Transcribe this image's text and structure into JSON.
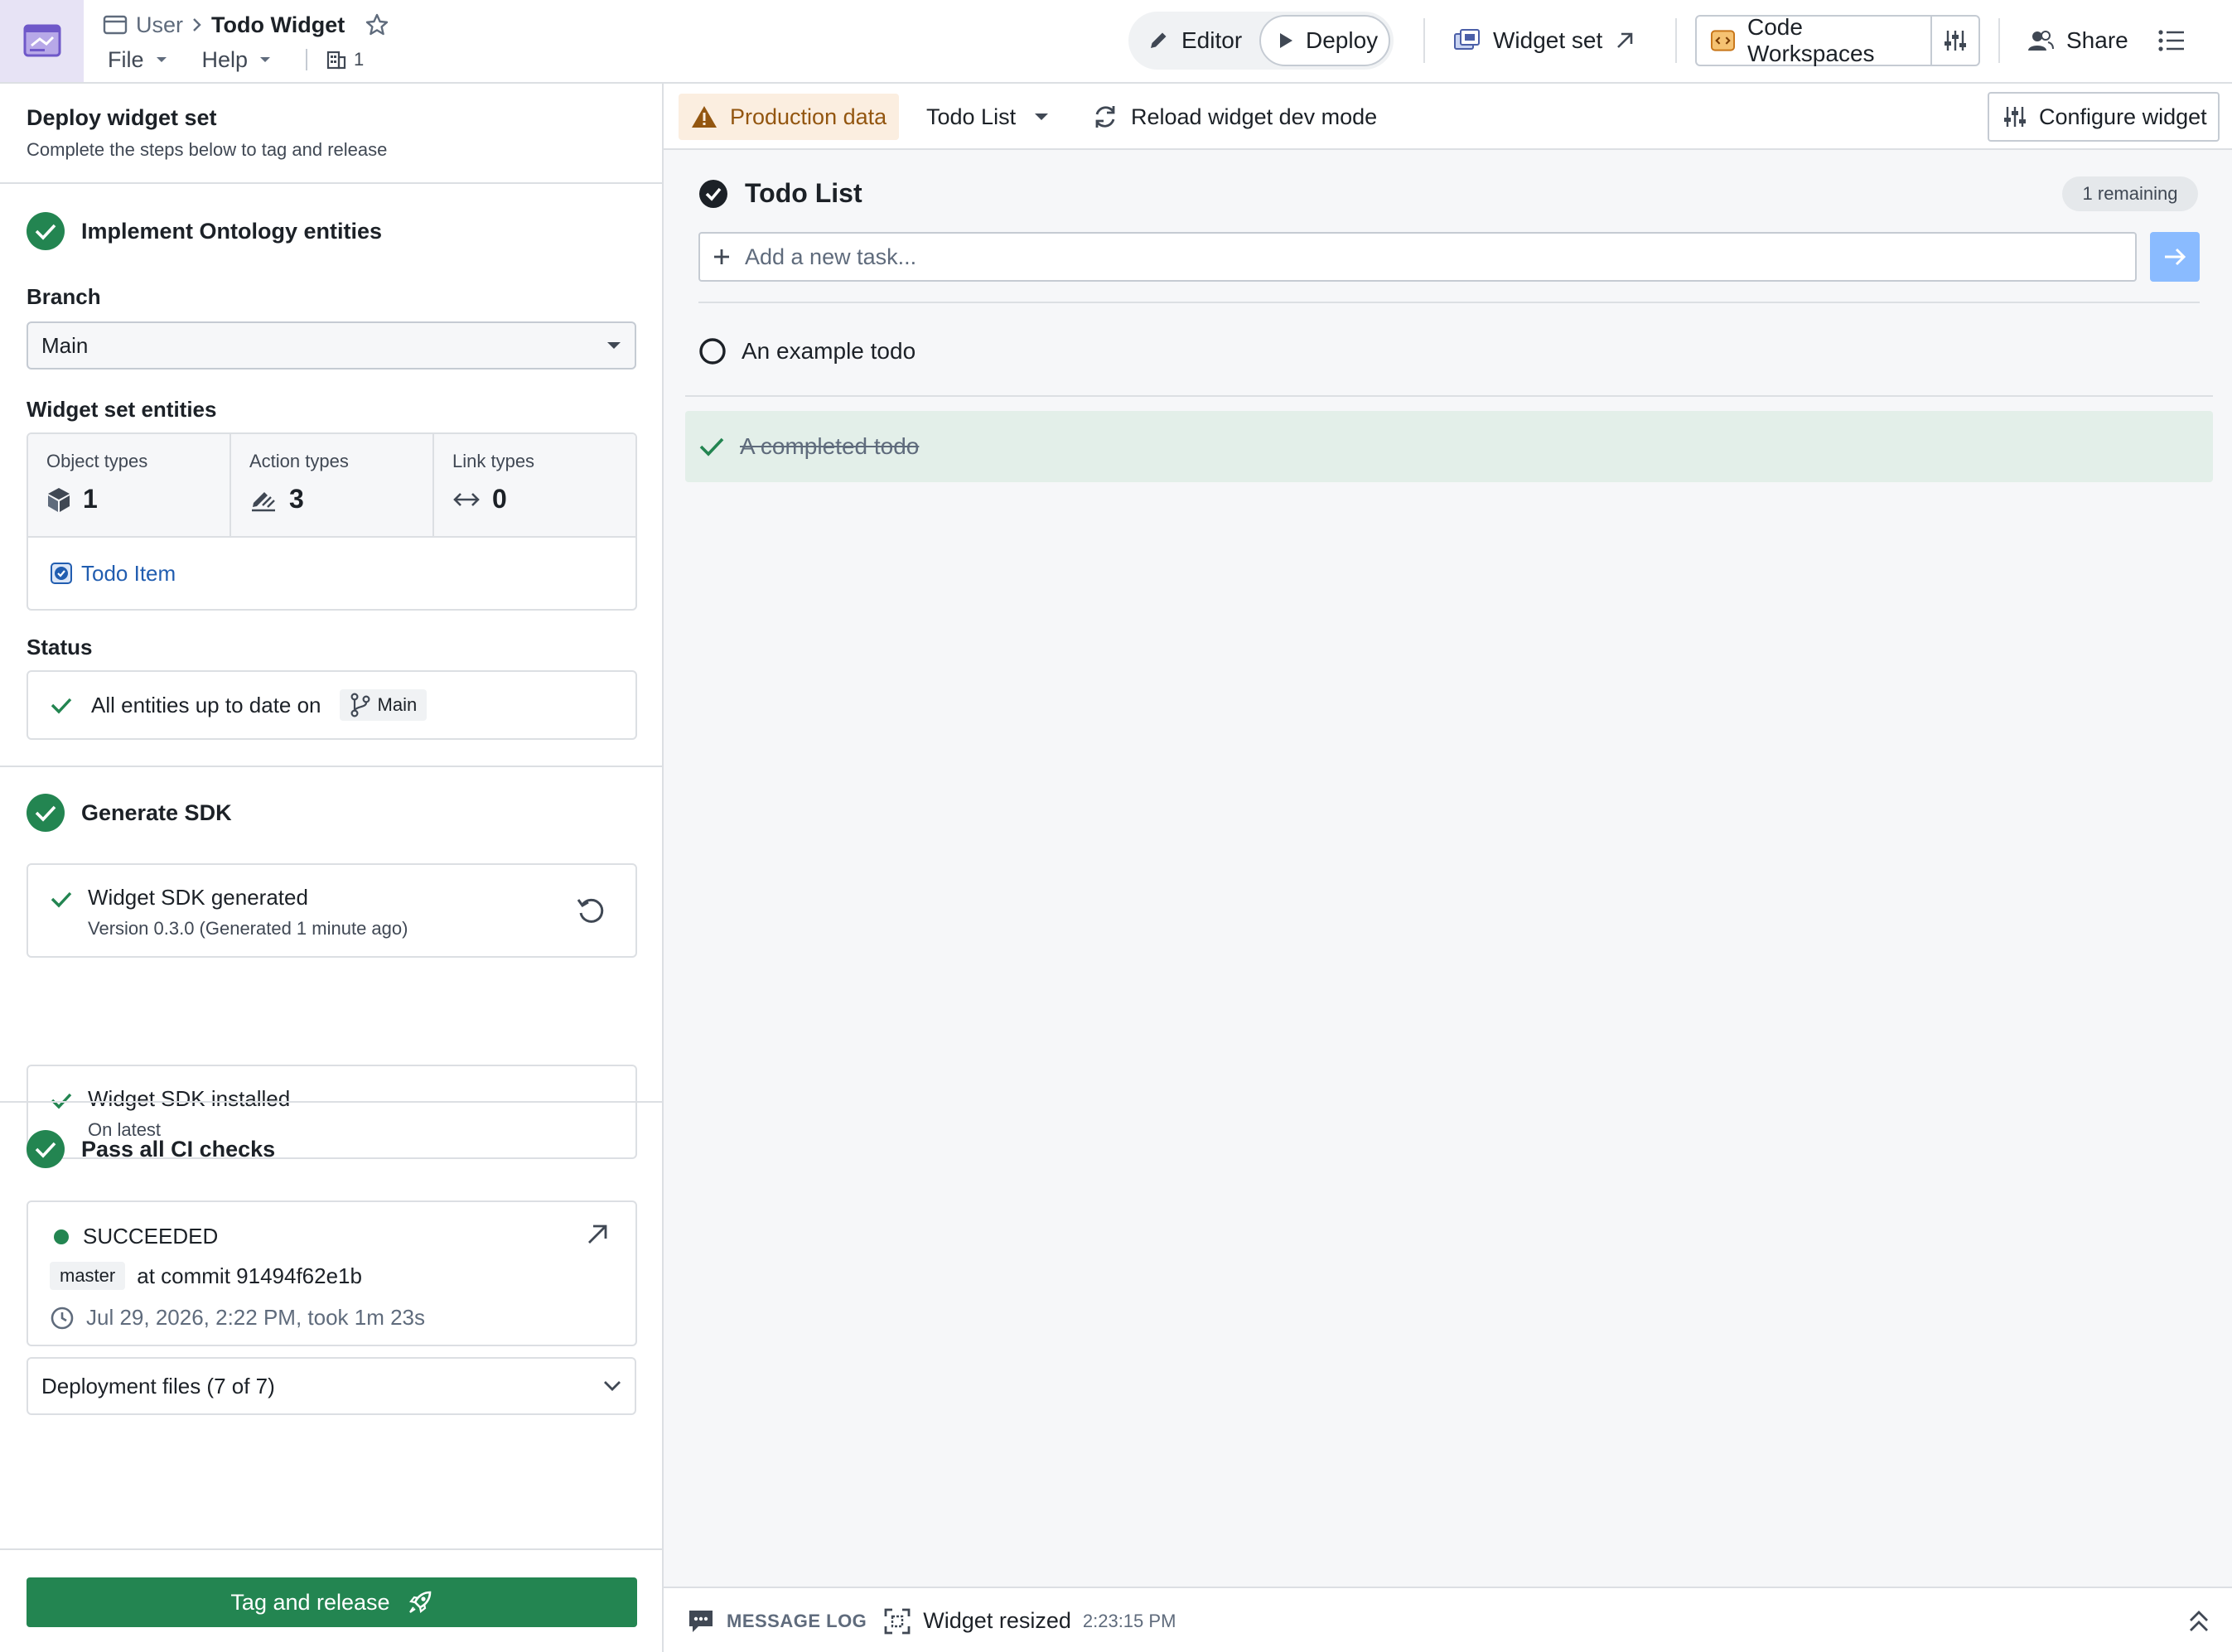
{
  "header": {
    "breadcrumb_parent": "User",
    "title": "Todo Widget",
    "menus": [
      {
        "label": "File"
      },
      {
        "label": "Help"
      }
    ],
    "branch_count": "1",
    "modes": {
      "editor": "Editor",
      "deploy": "Deploy",
      "active": "Deploy"
    },
    "widget_set_label": "Widget set",
    "code_workspaces_label": "Code Workspaces",
    "share_label": "Share"
  },
  "left_panel": {
    "title": "Deploy widget set",
    "subtitle": "Complete the steps below to tag and release",
    "step1": {
      "title": "Implement Ontology entities",
      "branch_label": "Branch",
      "branch_value": "Main",
      "entities_label": "Widget set entities",
      "entities": [
        {
          "label": "Object types",
          "value": "1",
          "icon": "cube-icon"
        },
        {
          "label": "Action types",
          "value": "3",
          "icon": "edit-action-icon"
        },
        {
          "label": "Link types",
          "value": "0",
          "icon": "arrows-horizontal-icon"
        }
      ],
      "object_item": "Todo Item",
      "status_label": "Status",
      "status_text": "All entities up to date on",
      "status_branch": "Main"
    },
    "step2": {
      "title": "Generate SDK",
      "generated_title": "Widget SDK generated",
      "generated_sub": "Version 0.3.0 (Generated 1 minute ago)",
      "installed_title": "Widget SDK installed",
      "installed_sub": "On latest"
    },
    "step3": {
      "title": "Pass all CI checks",
      "ci_status": "SUCCEEDED",
      "ci_branch": "master",
      "ci_commit": "at commit 91494f62e1b",
      "ci_time": "Jul 29, 2026, 2:22 PM, took 1m 23s",
      "deployment_files": "Deployment files (7 of 7)"
    },
    "release_button": "Tag and release"
  },
  "toolbar": {
    "production_badge": "Production data",
    "widget_select": "Todo List",
    "reload_label": "Reload widget dev mode",
    "configure_label": "Configure widget"
  },
  "widget": {
    "title": "Todo List",
    "remaining": "1 remaining",
    "input_placeholder": "Add a new task...",
    "todos": [
      {
        "text": "An example todo",
        "completed": false
      },
      {
        "text": "A completed todo",
        "completed": true
      }
    ]
  },
  "message_log": {
    "label": "MESSAGE LOG",
    "message": "Widget resized",
    "time": "2:23:15 PM"
  },
  "colors": {
    "success": "#238551",
    "primary": "#215db0",
    "warning_bg": "#fbeee0",
    "warning_text": "#935610",
    "completed_bg": "#e3efe9",
    "logo_bg": "#e7e3f5"
  }
}
